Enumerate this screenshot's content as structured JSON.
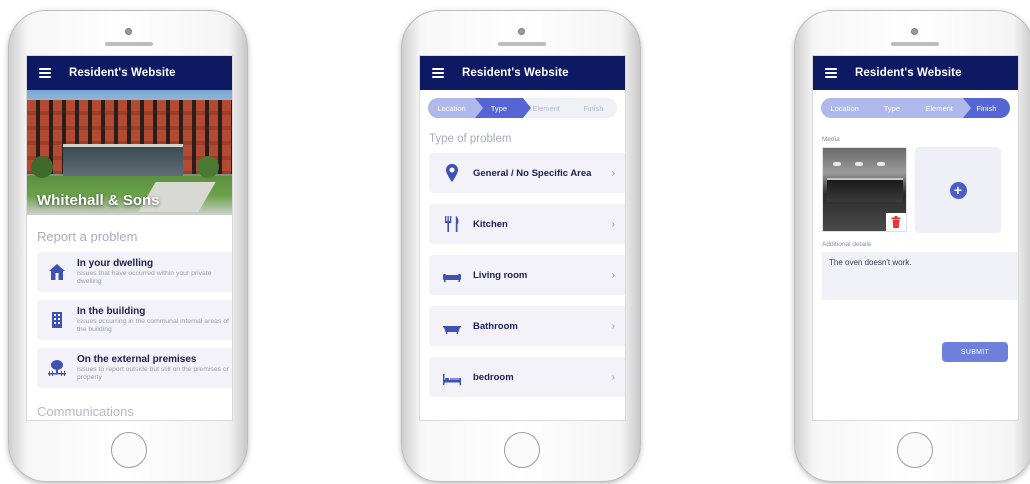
{
  "app": {
    "title": "Resident's Website"
  },
  "screen1": {
    "hero_title": "Whitehall & Sons",
    "report_title": "Report a problem",
    "items": [
      {
        "title": "In your dwelling",
        "desc": "Issues that have occurred within your private dwelling"
      },
      {
        "title": "In the building",
        "desc": "Issues occurring in the communal internal areas of the building"
      },
      {
        "title": "On the external premises",
        "desc": "Issues to report outside but still on the premises or property"
      }
    ],
    "communications_title": "Communications"
  },
  "stepper": {
    "steps": [
      "Location",
      "Type",
      "Element",
      "Finish"
    ]
  },
  "screen2": {
    "section_title": "Type of problem",
    "items": [
      {
        "label": "General / No Specific Area",
        "icon": "location-pin-icon"
      },
      {
        "label": "Kitchen",
        "icon": "fork-knife-icon"
      },
      {
        "label": "Living room",
        "icon": "sofa-icon"
      },
      {
        "label": "Bathroom",
        "icon": "bathtub-icon"
      },
      {
        "label": "bedroom",
        "icon": "bed-icon"
      }
    ],
    "chevron": "›"
  },
  "screen3": {
    "media_label": "Media",
    "details_label": "Additional details",
    "details_value": "The oven doesn't work.",
    "submit_label": "SUBMIT",
    "add_symbol": "+"
  },
  "colors": {
    "appbar": "#0d1a63",
    "accent": "#5566d4",
    "step_done": "#aeb8ea",
    "submit": "#6f7fdc",
    "delete": "#e53935"
  }
}
